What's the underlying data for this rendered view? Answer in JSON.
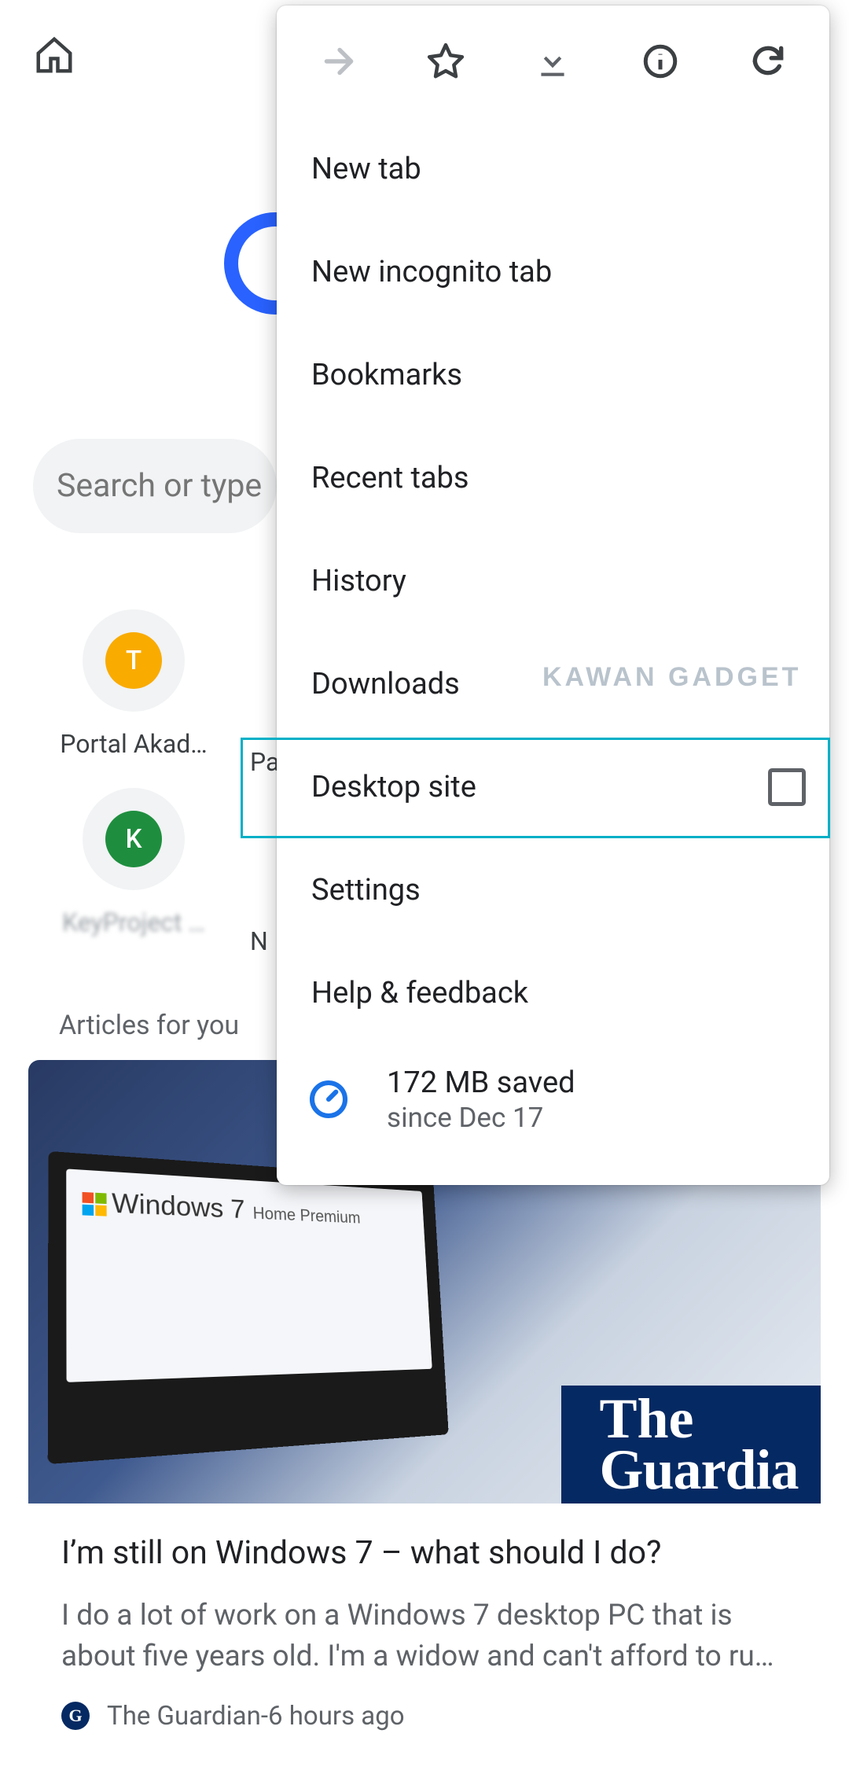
{
  "toolbar": {
    "home_icon": "home-icon"
  },
  "ntp": {
    "search_placeholder": "Search or type",
    "shortcuts": [
      {
        "letter": "T",
        "color": "#f9ab00",
        "label": "Portal Akad…"
      },
      {
        "letter": "K",
        "color": "#1e8e3e",
        "label": "KeyProject …"
      }
    ],
    "shortcut_partial_1": "Pa",
    "shortcut_partial_2": "N",
    "articles_heading": "Articles for you"
  },
  "article": {
    "screen_os": "Windows",
    "screen_ver": "7",
    "screen_edition": "Home Premium",
    "publisher_logo_text": "The Guardian",
    "title": "I’m still on Windows 7 – what should I do?",
    "snippet": "I do a lot of work on a Windows 7 desktop PC that is about five years old. I'm a widow and can't afford to ru…",
    "source": "The Guardian",
    "sep": " - ",
    "time": "6 hours ago",
    "src_initial": "G"
  },
  "menu": {
    "icons": {
      "forward": "forward-icon",
      "star": "star-icon",
      "download": "download-icon",
      "info": "info-icon",
      "refresh": "refresh-icon"
    },
    "items": {
      "new_tab": "New tab",
      "new_incognito": "New incognito tab",
      "bookmarks": "Bookmarks",
      "recent_tabs": "Recent tabs",
      "history": "History",
      "downloads": "Downloads",
      "desktop_site": "Desktop site",
      "settings": "Settings",
      "help": "Help & feedback"
    },
    "data_saver": {
      "line1": "172 MB saved",
      "line2": "since Dec 17"
    }
  },
  "watermark": "KAWAN  GADGET"
}
